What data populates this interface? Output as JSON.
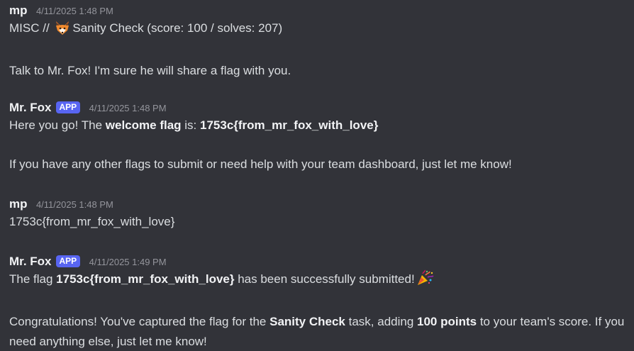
{
  "messages": [
    {
      "author": "mp",
      "timestamp": "4/11/2025 1:48 PM",
      "line1_prefix": "MISC // ",
      "line1_suffix": "Sanity Check (score: 100 / solves: 207)",
      "line2": "Talk to Mr. Fox! I'm sure he will share a flag with you.",
      "emoji": "fox-face"
    },
    {
      "author": "Mr. Fox",
      "badge": "APP",
      "timestamp": "4/11/2025 1:48 PM",
      "line1_a": "Here you go! The ",
      "line1_b": "welcome flag",
      "line1_c": " is: ",
      "line1_d": "1753c{from_mr_fox_with_love}",
      "line2": "If you have any other flags to submit or need help with your team dashboard, just let me know!"
    },
    {
      "author": "mp",
      "timestamp": "4/11/2025 1:48 PM",
      "line1": "1753c{from_mr_fox_with_love}"
    },
    {
      "author": "Mr. Fox",
      "badge": "APP",
      "timestamp": "4/11/2025 1:49 PM",
      "line1_a": "The flag ",
      "line1_b": "1753c{from_mr_fox_with_love}",
      "line1_c": " has been successfully submitted!",
      "emoji": "party-popper",
      "line2_a": "Congratulations! You've captured the flag for the ",
      "line2_b": "Sanity Check",
      "line2_c": " task, adding ",
      "line2_d": "100 points",
      "line2_e": " to your team's score. If you need anything else, just let me know!"
    }
  ]
}
